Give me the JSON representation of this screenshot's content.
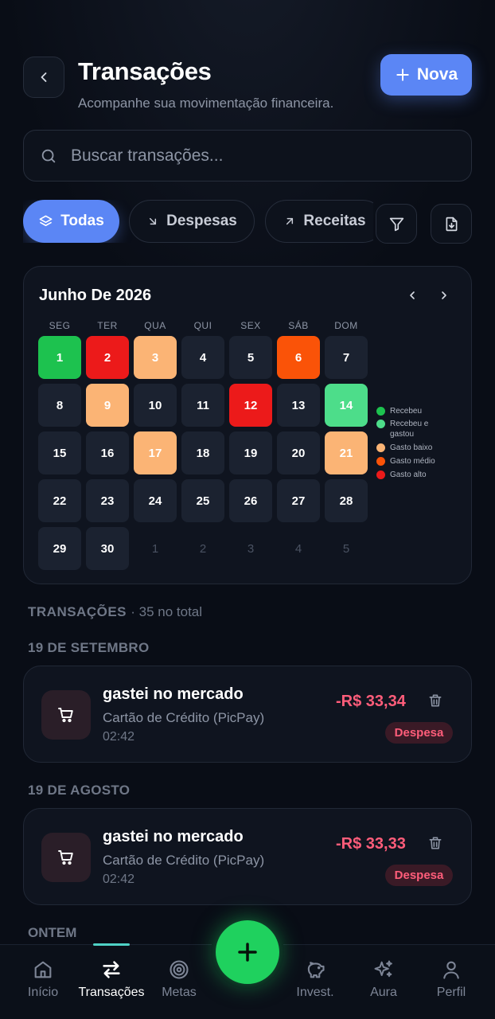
{
  "header": {
    "title": "Transações",
    "subtitle": "Acompanhe sua movimentação financeira.",
    "new_button": "Nova",
    "back_icon": "chevron-left-icon"
  },
  "search": {
    "placeholder": "Buscar transações..."
  },
  "filters": [
    {
      "label": "Todas",
      "icon": "layers-icon",
      "active": true
    },
    {
      "label": "Despesas",
      "icon": "arrow-down-right-icon",
      "active": false
    },
    {
      "label": "Receitas",
      "icon": "arrow-up-right-icon",
      "active": false
    }
  ],
  "tools": [
    "filter-icon",
    "file-download-icon"
  ],
  "calendar": {
    "month_label": "Junho De 2026",
    "weekdays": [
      "SEG",
      "TER",
      "QUA",
      "QUI",
      "SEX",
      "SÁB",
      "DOM"
    ],
    "days": [
      {
        "d": "1",
        "s": "recebeu"
      },
      {
        "d": "2",
        "s": "alto"
      },
      {
        "d": "3",
        "s": "baixo"
      },
      {
        "d": "4",
        "s": "normal"
      },
      {
        "d": "5",
        "s": "normal"
      },
      {
        "d": "6",
        "s": "medio"
      },
      {
        "d": "7",
        "s": "normal"
      },
      {
        "d": "8",
        "s": "normal"
      },
      {
        "d": "9",
        "s": "baixo"
      },
      {
        "d": "10",
        "s": "normal"
      },
      {
        "d": "11",
        "s": "normal"
      },
      {
        "d": "12",
        "s": "alto"
      },
      {
        "d": "13",
        "s": "normal"
      },
      {
        "d": "14",
        "s": "recgast"
      },
      {
        "d": "15",
        "s": "normal"
      },
      {
        "d": "16",
        "s": "normal"
      },
      {
        "d": "17",
        "s": "baixo"
      },
      {
        "d": "18",
        "s": "normal"
      },
      {
        "d": "19",
        "s": "normal"
      },
      {
        "d": "20",
        "s": "normal"
      },
      {
        "d": "21",
        "s": "baixo"
      },
      {
        "d": "22",
        "s": "normal"
      },
      {
        "d": "23",
        "s": "normal"
      },
      {
        "d": "24",
        "s": "normal"
      },
      {
        "d": "25",
        "s": "normal"
      },
      {
        "d": "26",
        "s": "normal"
      },
      {
        "d": "27",
        "s": "normal"
      },
      {
        "d": "28",
        "s": "normal"
      },
      {
        "d": "29",
        "s": "normal"
      },
      {
        "d": "30",
        "s": "normal"
      },
      {
        "d": "1",
        "s": "next"
      },
      {
        "d": "2",
        "s": "next"
      },
      {
        "d": "3",
        "s": "next"
      },
      {
        "d": "4",
        "s": "next"
      },
      {
        "d": "5",
        "s": "next"
      }
    ],
    "legend": [
      {
        "label": "Recebeu",
        "color": "#1dc24f"
      },
      {
        "label": "Recebeu e gastou",
        "color": "#4ddd8a"
      },
      {
        "label": "Gasto baixo",
        "color": "#fbb475"
      },
      {
        "label": "Gasto médio",
        "color": "#fa5308"
      },
      {
        "label": "Gasto alto",
        "color": "#ec1a1a"
      }
    ]
  },
  "transactions": {
    "section_label": "TRANSAÇÕES",
    "count_label": "· 35 no total",
    "groups": [
      {
        "date": "19 DE SETEMBRO",
        "items": [
          {
            "title": "gastei no mercado",
            "account": "Cartão de Crédito (PicPay)",
            "time": "02:42",
            "amount": "-R$ 33,34",
            "type": "Despesa",
            "icon": "shopping-cart-icon"
          }
        ]
      },
      {
        "date": "19 DE AGOSTO",
        "items": [
          {
            "title": "gastei no mercado",
            "account": "Cartão de Crédito (PicPay)",
            "time": "02:42",
            "amount": "-R$ 33,33",
            "type": "Despesa",
            "icon": "shopping-cart-icon"
          }
        ]
      }
    ],
    "next_group": "ONTEM"
  },
  "bottom_nav": {
    "items": [
      {
        "label": "Início",
        "icon": "home-icon",
        "active": false
      },
      {
        "label": "Transações",
        "icon": "transfer-arrows-icon",
        "active": true
      },
      {
        "label": "Metas",
        "icon": "target-icon",
        "active": false
      },
      {
        "label": "Invest.",
        "icon": "piggy-bank-icon",
        "active": false
      },
      {
        "label": "Aura",
        "icon": "sparkles-icon",
        "active": false
      },
      {
        "label": "Perfil",
        "icon": "user-icon",
        "active": false
      }
    ],
    "fab_icon": "plus-icon"
  },
  "colors": {
    "accent": "#5b86f5",
    "expense": "#ff5d7a",
    "fab": "#1fd15e",
    "background": "#090d16"
  }
}
